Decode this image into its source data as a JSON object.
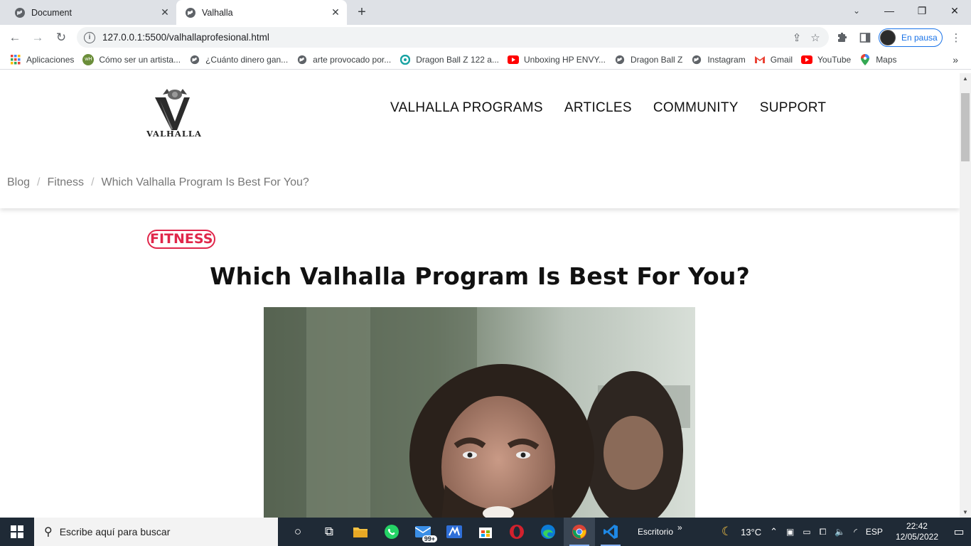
{
  "tabs": [
    {
      "title": "Document",
      "active": false
    },
    {
      "title": "Valhalla",
      "active": true
    }
  ],
  "omnibox": {
    "url": "127.0.0.1:5500/valhallaprofesional.html"
  },
  "profile": {
    "label": "En pausa"
  },
  "bookmarks": [
    {
      "label": "Aplicaciones",
      "icon": "apps-grid-icon"
    },
    {
      "label": "Cómo ser un artista...",
      "icon": "wikihow-icon"
    },
    {
      "label": "¿Cuánto dinero gan...",
      "icon": "globe-icon"
    },
    {
      "label": "arte provocado por...",
      "icon": "globe-icon"
    },
    {
      "label": "Dragon Ball Z 122 a...",
      "icon": "circle-teal-icon"
    },
    {
      "label": "Unboxing HP ENVY...",
      "icon": "youtube-icon"
    },
    {
      "label": "Dragon Ball Z",
      "icon": "globe-icon"
    },
    {
      "label": "Instagram",
      "icon": "globe-icon"
    },
    {
      "label": "Gmail",
      "icon": "gmail-icon"
    },
    {
      "label": "YouTube",
      "icon": "youtube-icon"
    },
    {
      "label": "Maps",
      "icon": "maps-icon"
    }
  ],
  "site": {
    "logo_text": "VALHALLA",
    "nav": [
      "VALHALLA PROGRAMS",
      "ARTICLES",
      "COMMUNITY",
      "SUPPORT"
    ],
    "breadcrumb": [
      "Blog",
      "Fitness",
      "Which Valhalla Program Is Best For You?"
    ],
    "badge": "FITNESS",
    "title": "Which Valhalla Program Is Best For You?"
  },
  "taskbar": {
    "search_placeholder": "Escribe aquí para buscar",
    "desktop_label": "Escritorio",
    "mail_badge": "99+",
    "temperature": "13°C",
    "language": "ESP",
    "time": "22:42",
    "date": "12/05/2022"
  },
  "colors": {
    "accent": "#e0264a",
    "taskbar": "#1f2a36",
    "chrome_tab_bg": "#dee1e6"
  }
}
